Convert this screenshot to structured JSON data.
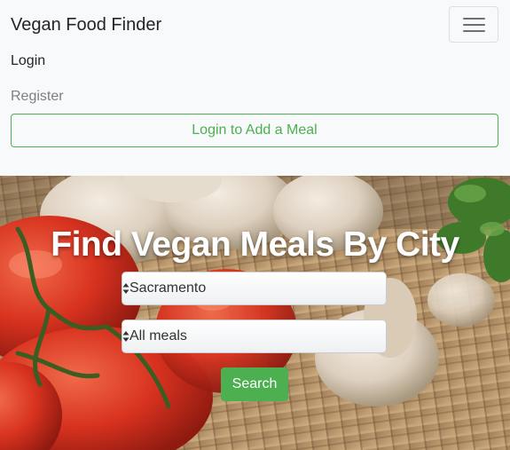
{
  "navbar": {
    "brand": "Vegan Food Finder",
    "toggler_icon": "hamburger-icon",
    "links": {
      "login": "Login",
      "register": "Register"
    },
    "add_meal_button": "Login to Add a Meal"
  },
  "hero": {
    "title": "Find Vegan Meals By City",
    "city_select": {
      "value": "Sacramento",
      "icon": "select-arrows-icon"
    },
    "meal_select": {
      "value": "All meals",
      "icon": "select-arrows-icon"
    },
    "search_button": "Search"
  },
  "colors": {
    "accent": "#4caf50",
    "navbar_bg": "#f8f9fa"
  }
}
